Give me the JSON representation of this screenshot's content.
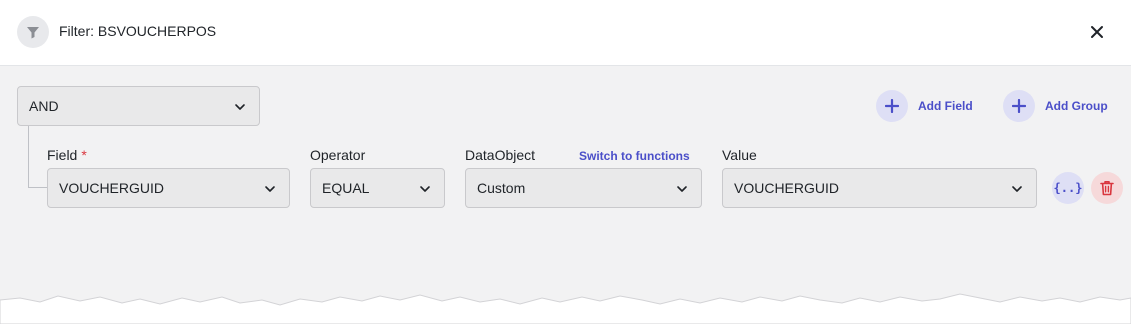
{
  "header": {
    "title": "Filter: BSVOUCHERPOS",
    "icon": "filter-icon",
    "close_icon": "close-icon"
  },
  "group": {
    "logic_value": "AND",
    "add_field_label": "Add Field",
    "add_group_label": "Add Group"
  },
  "row": {
    "field_label": "Field",
    "field_required_mark": "*",
    "field_value": "VOUCHERGUID",
    "operator_label": "Operator",
    "operator_value": "EQUAL",
    "dataobject_label": "DataObject",
    "switch_link": "Switch to functions",
    "dataobject_value": "Custom",
    "value_label": "Value",
    "value_value": "VOUCHERGUID",
    "expression_button": "{..}",
    "delete_icon": "trash-icon"
  },
  "colors": {
    "accent": "#4b4fc9",
    "accent_bg": "#dedff5",
    "danger": "#d9363e",
    "danger_bg": "#f6d9da",
    "panel_bg": "#f2f2f3"
  }
}
